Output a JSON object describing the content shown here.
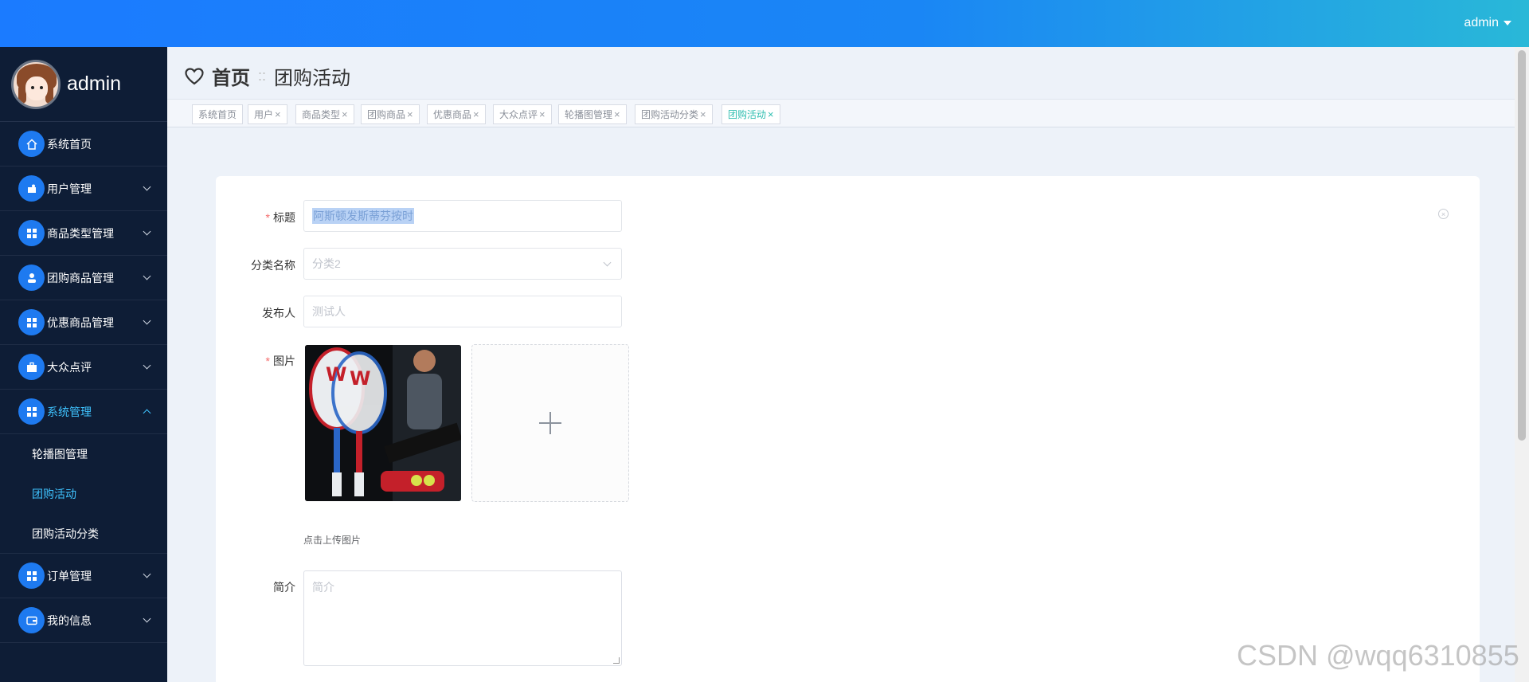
{
  "topbar": {
    "username": "admin"
  },
  "sidebar": {
    "profile_name": "admin",
    "items": [
      {
        "label": "系统首页",
        "icon": "home-icon"
      },
      {
        "label": "用户管理",
        "icon": "user-card-icon"
      },
      {
        "label": "商品类型管理",
        "icon": "grid-icon"
      },
      {
        "label": "团购商品管理",
        "icon": "person-icon"
      },
      {
        "label": "优惠商品管理",
        "icon": "grid-icon"
      },
      {
        "label": "大众点评",
        "icon": "briefcase-icon"
      },
      {
        "label": "系统管理",
        "icon": "grid-icon",
        "expanded": true
      },
      {
        "label": "订单管理",
        "icon": "grid-icon"
      },
      {
        "label": "我的信息",
        "icon": "wallet-icon"
      }
    ],
    "submenu": [
      {
        "label": "轮播图管理"
      },
      {
        "label": "团购活动",
        "active": true
      },
      {
        "label": "团购活动分类"
      }
    ]
  },
  "breadcrumb": {
    "home": "首页",
    "separator": "::",
    "current": "团购活动"
  },
  "tabs": [
    {
      "label": "系统首页"
    },
    {
      "label": "用户"
    },
    {
      "label": "商品类型"
    },
    {
      "label": "团购商品"
    },
    {
      "label": "优惠商品"
    },
    {
      "label": "大众点评"
    },
    {
      "label": "轮播图管理"
    },
    {
      "label": "团购活动分类"
    },
    {
      "label": "团购活动",
      "active": true
    }
  ],
  "tab_close": "×",
  "form": {
    "title": {
      "label": "标题",
      "required_mark": "*",
      "value": "阿斯顿发斯蒂芬按时"
    },
    "category": {
      "label": "分类名称",
      "value": "分类2"
    },
    "publisher": {
      "label": "发布人",
      "value": "测试人"
    },
    "image": {
      "label": "图片",
      "required_mark": "*",
      "hint": "点击上传图片"
    },
    "intro": {
      "label": "简介",
      "placeholder": "简介"
    }
  },
  "watermark": "CSDN @wqq6310855",
  "colors": {
    "topbar_start": "#1b7bff",
    "topbar_end": "#29b8d8",
    "sidebar_bg": "#0e1d36",
    "active": "#3fc3ff",
    "tab_active": "#2fbeb0"
  }
}
